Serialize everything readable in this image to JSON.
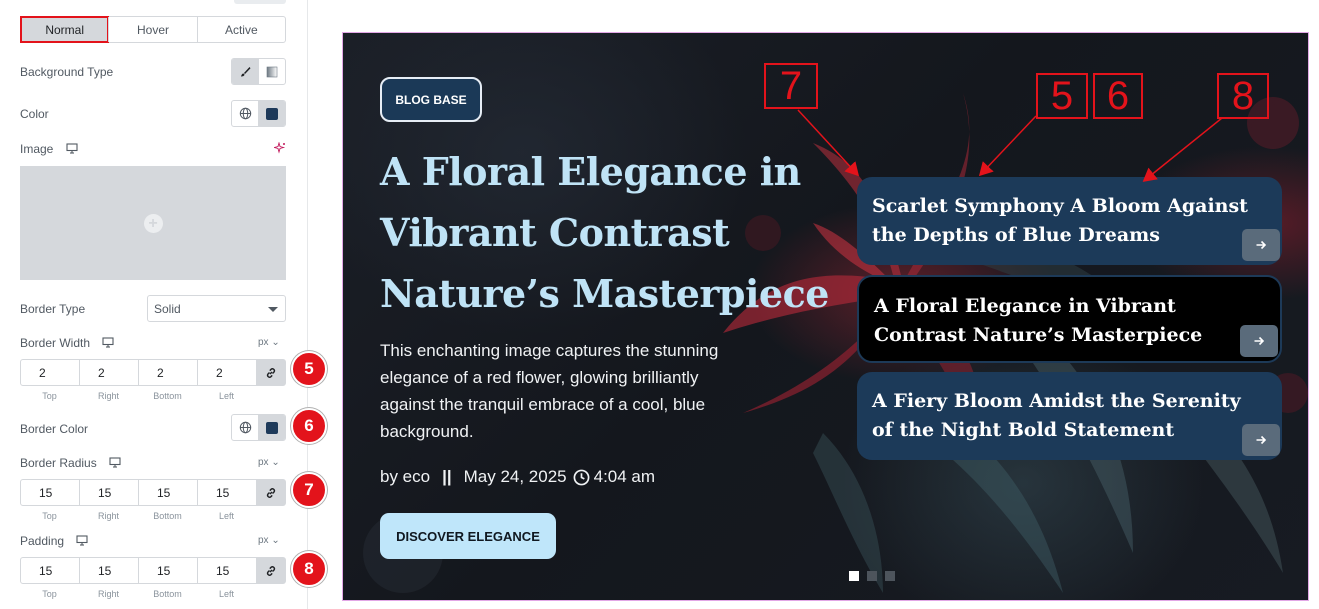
{
  "panel": {
    "tabs": [
      {
        "label": "Normal",
        "active": true
      },
      {
        "label": "Hover",
        "active": false
      },
      {
        "label": "Active",
        "active": false
      }
    ],
    "background_type_label": "Background Type",
    "color_label": "Color",
    "image_label": "Image",
    "border_type": {
      "label": "Border Type",
      "value": "Solid"
    },
    "border_width": {
      "label": "Border Width",
      "unit": "px",
      "values": [
        "2",
        "2",
        "2",
        "2"
      ]
    },
    "border_color_label": "Border Color",
    "border_radius": {
      "label": "Border Radius",
      "unit": "px",
      "values": [
        "15",
        "15",
        "15",
        "15"
      ]
    },
    "padding": {
      "label": "Padding",
      "unit": "px",
      "values": [
        "15",
        "15",
        "15",
        "15"
      ]
    },
    "side_labels": [
      "Top",
      "Right",
      "Bottom",
      "Left"
    ],
    "swatch_color": "#1e3a5a"
  },
  "badges": [
    "5",
    "6",
    "7",
    "8"
  ],
  "preview": {
    "category": "BLOG BASE",
    "title": "A Floral Elegance in Vibrant Contrast Nature’s Masterpiece",
    "description": "This enchanting image captures the stunning elegance of a red flower, glowing brilliantly against the tranquil embrace of a cool, blue background.",
    "author": "by eco",
    "separator": "||",
    "date": "May 24, 2025",
    "time": "4:04 am",
    "cta": "DISCOVER ELEGANCE",
    "cards": [
      {
        "title": "Scarlet Symphony A Bloom Against the Depths of Blue Dreams"
      },
      {
        "title": "A Floral Elegance in Vibrant Contrast Nature’s Masterpiece"
      },
      {
        "title": "A Fiery Bloom Amidst the Serenity of the Night Bold Statement"
      }
    ],
    "active_dot": 1,
    "dot_count": 3
  },
  "annotations": [
    "7",
    "5",
    "6",
    "8"
  ],
  "colors": {
    "highlight": "#e3131b",
    "card_bg": "#1c3a59",
    "title_color": "#bfe3f6",
    "cta_bg": "#bfe6fa"
  }
}
